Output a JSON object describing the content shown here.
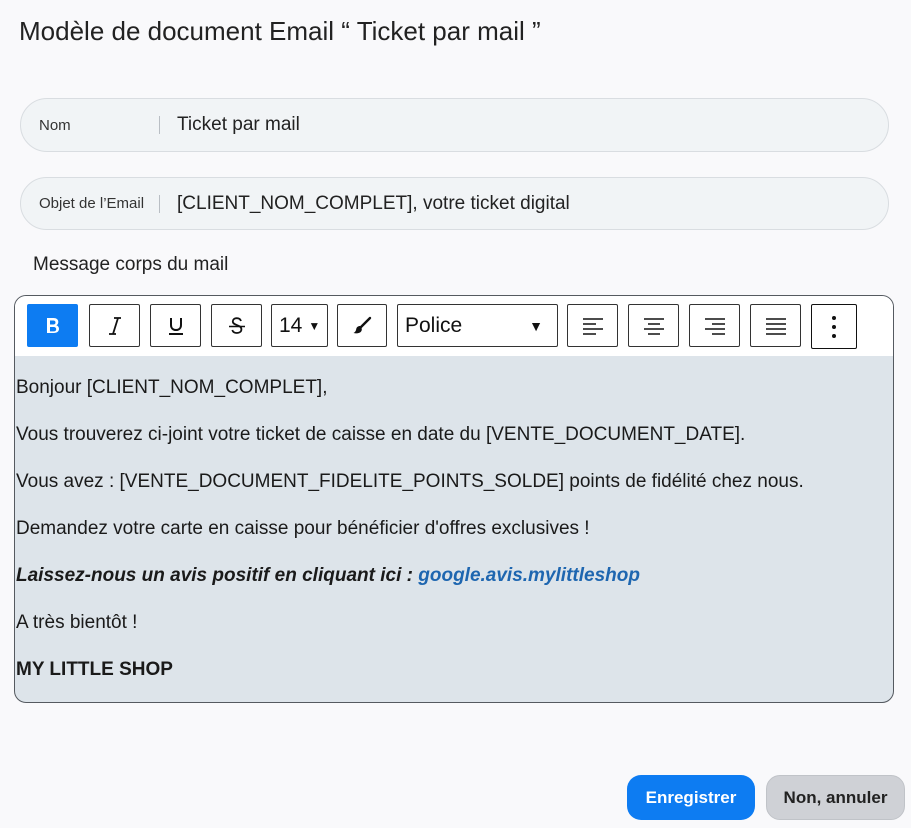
{
  "page": {
    "title": "Modèle de document Email “ Ticket par mail ”"
  },
  "fields": {
    "name": {
      "label": "Nom",
      "value": "Ticket par mail"
    },
    "subject": {
      "label": "Objet de l’Email",
      "value": "[CLIENT_NOM_COMPLET], votre ticket digital"
    }
  },
  "editor": {
    "label": "Message corps du mail",
    "toolbar": {
      "bold_icon": "bold-icon",
      "italic_icon": "italic-icon",
      "underline_icon": "underline-icon",
      "strike_icon": "strikethrough-icon",
      "font_size": "14",
      "color_icon": "brush-icon",
      "font_family": "Police",
      "align_left_icon": "align-left-icon",
      "align_center_icon": "align-center-icon",
      "align_right_icon": "align-right-icon",
      "align_justify_icon": "align-justify-icon",
      "more_icon": "more-vertical-icon"
    },
    "body": {
      "line1": "Bonjour [CLIENT_NOM_COMPLET],",
      "line2": "Vous trouverez ci-joint votre ticket de caisse en date du [VENTE_DOCUMENT_DATE].",
      "line3": "Vous avez : [VENTE_DOCUMENT_FIDELITE_POINTS_SOLDE] points de fidélité chez nous.",
      "line4": "Demandez votre carte en caisse pour bénéficier d'offres exclusives !",
      "review_text": "Laissez-nous un avis positif en cliquant ici : ",
      "review_link": "google.avis.mylittleshop",
      "line6": "A très bientôt !",
      "signature": "MY LITTLE SHOP"
    }
  },
  "actions": {
    "save": "Enregistrer",
    "cancel": "Non, annuler"
  },
  "colors": {
    "accent": "#0d7cf2",
    "link": "#1e66b0",
    "editor_bg": "#dde4ea"
  }
}
